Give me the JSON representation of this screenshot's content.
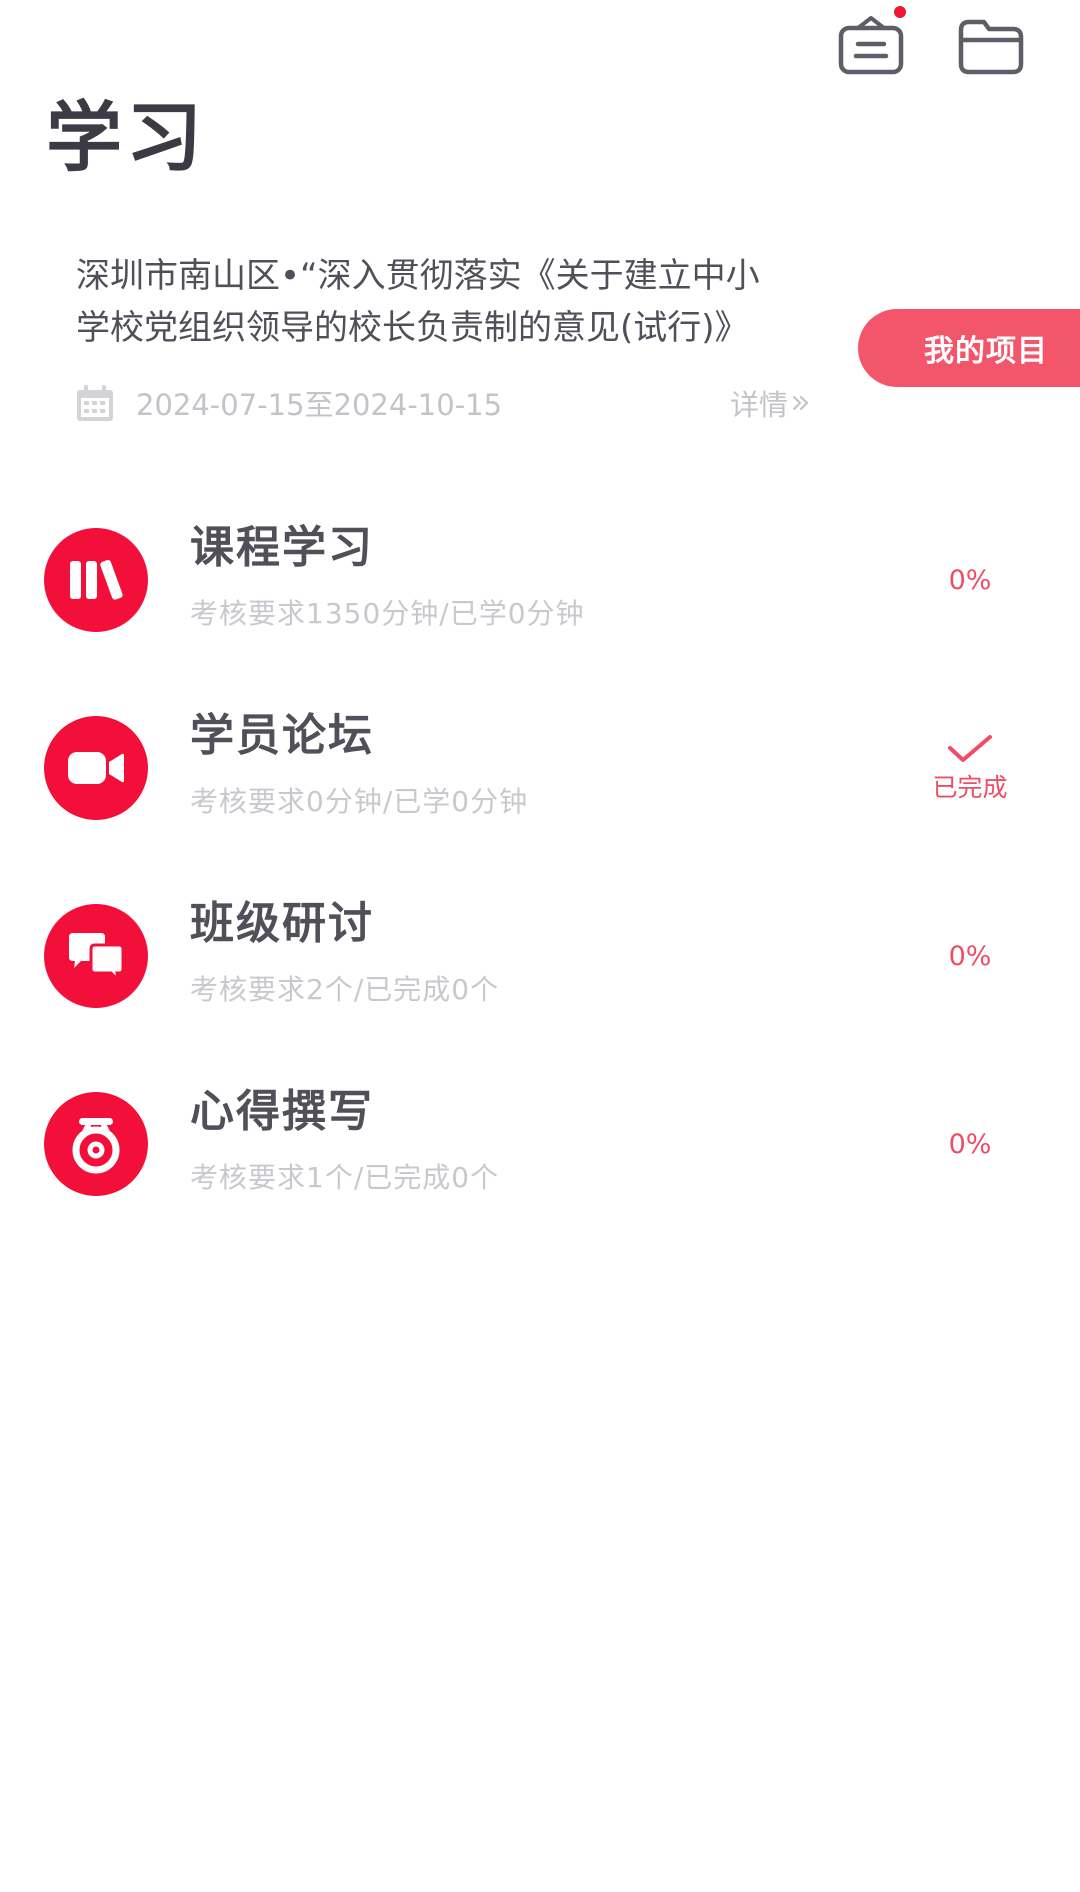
{
  "header": {
    "title": "学习",
    "icons": [
      "inbox-icon",
      "folder-icon"
    ],
    "notification_dot_color": "#ee1733"
  },
  "project": {
    "title_line1": "深圳市南山区•“深入贯彻落实《关于建立中小",
    "title_line2": "学校党组织领导的校长负责制的意见(试行)》",
    "date_range": "2024-07-15至2024-10-15",
    "detail_label": "详情",
    "my_project_label": "我的项目"
  },
  "tasks": [
    {
      "title": "课程学习",
      "requirement": "考核要求1350分钟/已学0分钟",
      "status_text": "0%",
      "progress": 0,
      "icon": "books-icon"
    },
    {
      "title": "学员论坛",
      "requirement": "考核要求0分钟/已学0分钟",
      "status_text": "已完成",
      "completed": true,
      "icon": "video-camera-icon"
    },
    {
      "title": "班级研讨",
      "requirement": "考核要求2个/已完成0个",
      "status_text": "0%",
      "progress": 0,
      "icon": "chat-bubbles-icon"
    },
    {
      "title": "心得撰写",
      "requirement": "考核要求1个/已完成0个",
      "status_text": "0%",
      "progress": 0,
      "icon": "medal-icon"
    }
  ],
  "colors": {
    "accent": "#f2103a",
    "button": "#f3566b",
    "status": "#ef4d65"
  }
}
